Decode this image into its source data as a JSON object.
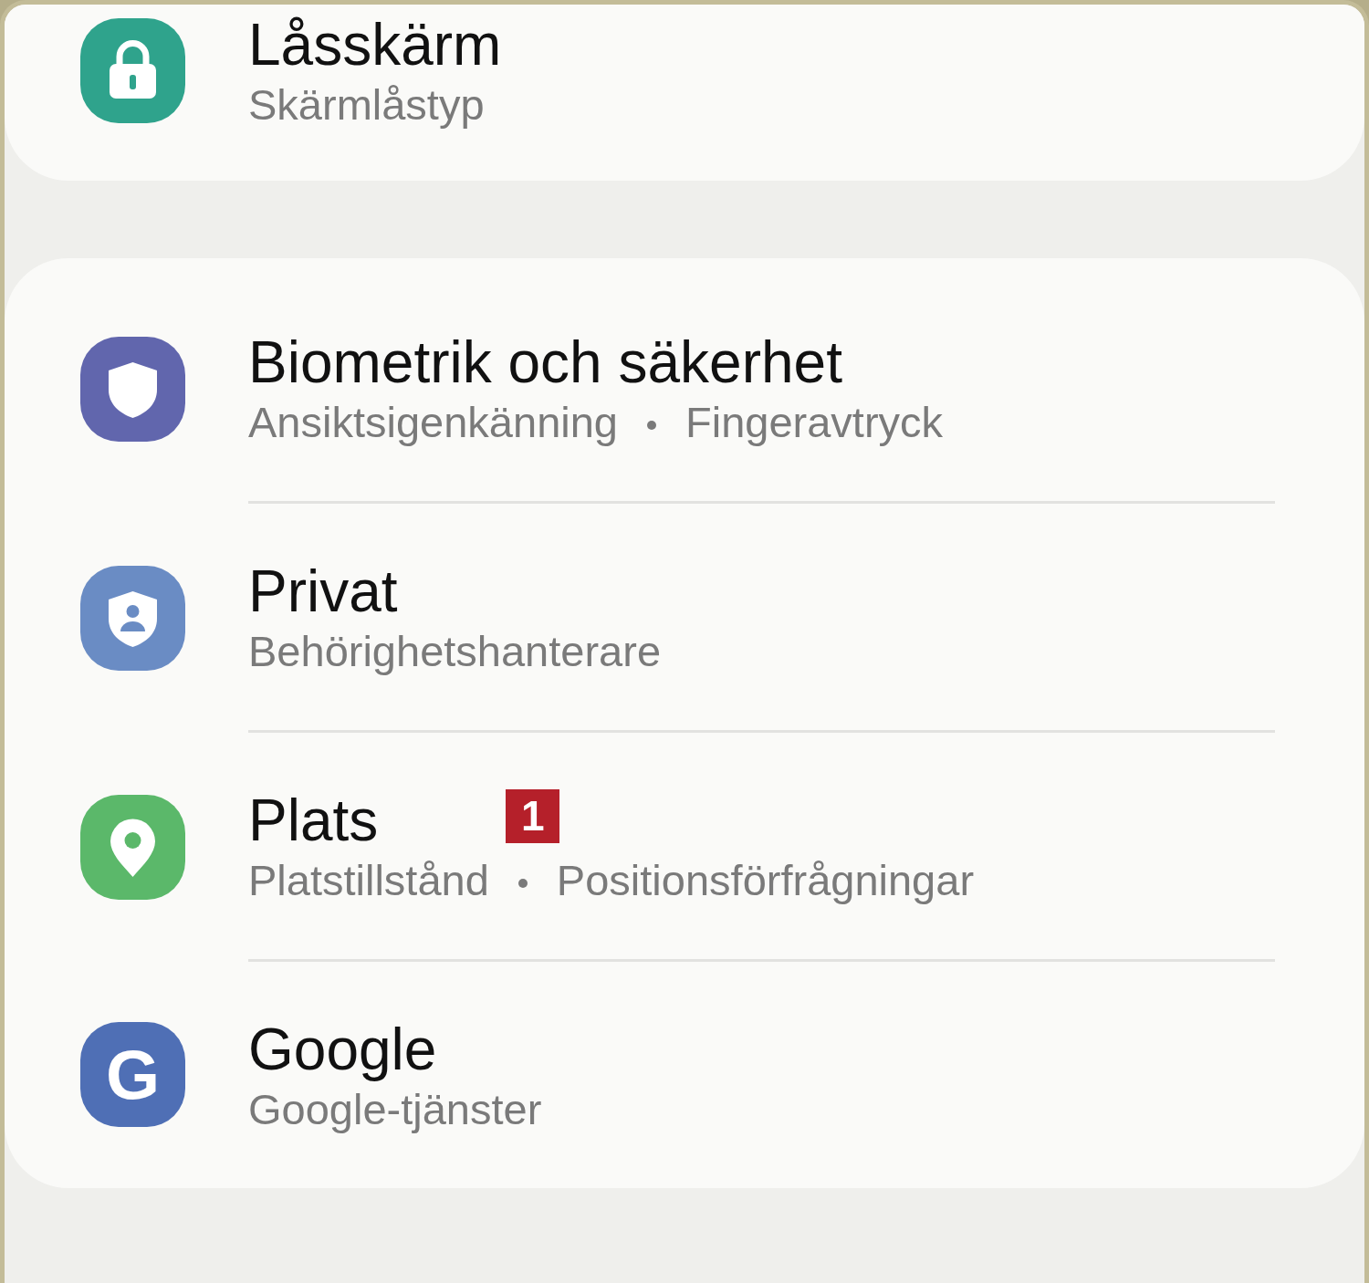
{
  "sections": [
    {
      "items": [
        {
          "title": "Låsskärm",
          "subtitle_parts": [
            "Skärmlåstyp"
          ],
          "icon": {
            "kind": "lock",
            "color": "#2fa38c"
          }
        }
      ]
    },
    {
      "items": [
        {
          "title": "Biometrik och säkerhet",
          "subtitle_parts": [
            "Ansiktsigenkänning",
            "Fingeravtryck"
          ],
          "icon": {
            "kind": "shield",
            "color": "#6166ad"
          }
        },
        {
          "title": "Privat",
          "subtitle_parts": [
            "Behörighetshanterare"
          ],
          "icon": {
            "kind": "person-shield",
            "color": "#6a8cc4"
          }
        },
        {
          "title": "Plats",
          "badge": "1",
          "subtitle_parts": [
            "Platstillstånd",
            "Positionsförfrågningar"
          ],
          "icon": {
            "kind": "pin",
            "color": "#5bb86a"
          }
        },
        {
          "title": "Google",
          "subtitle_parts": [
            "Google-tjänster"
          ],
          "icon": {
            "kind": "letter",
            "text": "G",
            "color": "#4f6fb5"
          }
        }
      ]
    }
  ]
}
